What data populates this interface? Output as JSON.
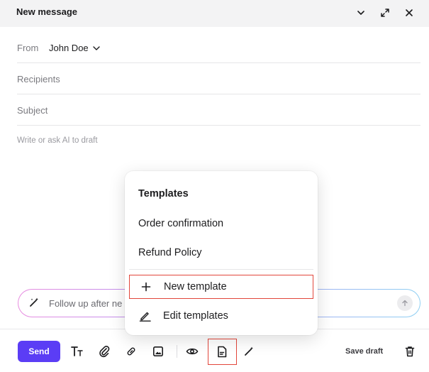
{
  "header": {
    "title": "New message",
    "icons": [
      "chevron-down-icon",
      "expand-icon",
      "close-icon"
    ]
  },
  "from": {
    "label": "From",
    "name": "John Doe"
  },
  "recipients": {
    "label": "Recipients"
  },
  "subject": {
    "label": "Subject"
  },
  "body": {
    "placeholder": "Write or ask AI to draft"
  },
  "prompt": {
    "text": "Follow up after ne"
  },
  "toolbar": {
    "send_label": "Send",
    "save_draft_label": "Save draft",
    "icons": [
      "text-format-icon",
      "attachment-icon",
      "link-icon",
      "image-icon",
      "preview-eye-icon",
      "template-icon",
      "ai-wand-icon",
      "trash-icon"
    ]
  },
  "templates_menu": {
    "title": "Templates",
    "items": [
      "Order confirmation",
      "Refund Policy"
    ],
    "actions": [
      {
        "label": "New template",
        "icon": "plus-icon"
      },
      {
        "label": "Edit templates",
        "icon": "pencil-icon"
      }
    ]
  },
  "colors": {
    "accent": "#5b3df5",
    "highlight": "#e2463b"
  }
}
